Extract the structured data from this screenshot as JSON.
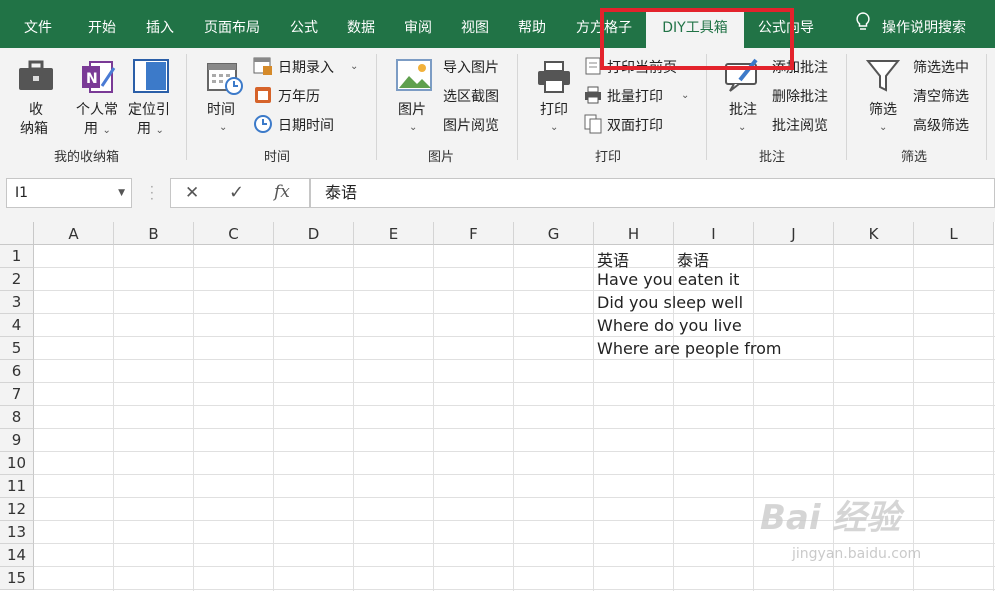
{
  "tabs": [
    "文件",
    "开始",
    "插入",
    "页面布局",
    "公式",
    "数据",
    "审阅",
    "视图",
    "帮助",
    "方方格子",
    "DIY工具箱",
    "公式向导",
    "操作说明搜索"
  ],
  "active_tab": "DIY工具箱",
  "ribbon": {
    "shoucang": {
      "shou": "收",
      "nawang": "纳箱",
      "geren1": "个人常",
      "geren2": "用",
      "dingwei1": "定位引",
      "dingwei2": "用",
      "label": "我的收纳箱"
    },
    "time": {
      "btn1": "时间",
      "riqi_luru": "日期录入",
      "wannianli": "万年历",
      "riqi_shijian": "日期时间",
      "label": "时间"
    },
    "image": {
      "btn": "图片",
      "daoru": "导入图片",
      "xuanqu": "选区截图",
      "yuelan": "图片阅览",
      "label": "图片"
    },
    "print": {
      "btn": "打印",
      "dangqian": "打印当前页",
      "piliang": "批量打印",
      "shuangmian": "双面打印",
      "label": "打印"
    },
    "comment": {
      "btn": "批注",
      "add": "添加批注",
      "del": "删除批注",
      "view": "批注阅览",
      "label": "批注"
    },
    "filter": {
      "btn": "筛选",
      "xuanzhong": "筛选选中",
      "qingkong": "清空筛选",
      "gaoji": "高级筛选",
      "label": "筛选"
    }
  },
  "formula_bar": {
    "name_box": "I1",
    "cancel": "✕",
    "enter": "✓",
    "fx": "fx",
    "value": "泰语"
  },
  "columns": [
    "A",
    "B",
    "C",
    "D",
    "E",
    "F",
    "G",
    "H",
    "I",
    "J",
    "K",
    "L"
  ],
  "rows": [
    "1",
    "2",
    "3",
    "4",
    "5",
    "6",
    "7",
    "8",
    "9",
    "10",
    "11",
    "12",
    "13",
    "14",
    "15"
  ],
  "cells": {
    "H1": "英语",
    "I1": "泰语",
    "H2": "Have you eaten it",
    "H3": "Did you sleep well",
    "H4": "Where do you live",
    "H5": "Where are people from"
  },
  "watermark": {
    "main": "Bai 经验",
    "sub": "jingyan.baidu.com"
  },
  "colors": {
    "brand": "#217346",
    "highlight": "#e3232c"
  }
}
